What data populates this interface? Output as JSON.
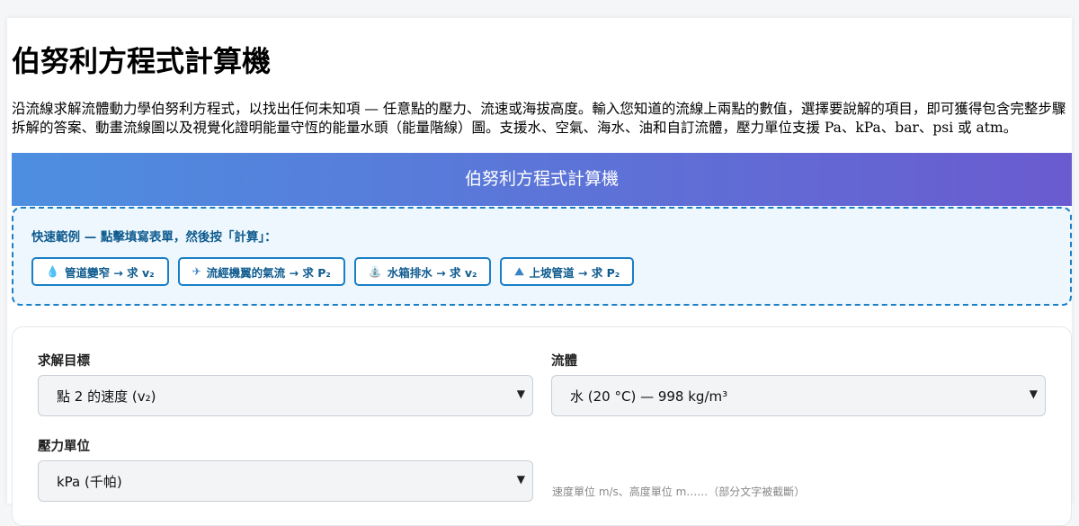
{
  "page": {
    "title": "伯努利方程式計算機",
    "description": "沿流線求解流體動力學伯努利方程式，以找出任何未知項 — 任意點的壓力、流速或海拔高度。輸入您知道的流線上兩點的數值，選擇要說解的項目，即可獲得包含完整步驟拆解的答案、動畫流線圖以及視覺化證明能量守恆的能量水頭（能量階線）圖。支援水、空氣、海水、油和自訂流體，壓力單位支援 Pa、kPa、bar、psi 或 atm。"
  },
  "banner": {
    "title": "伯努利方程式計算機"
  },
  "examples": {
    "label": "快速範例 — 點擊填寫表單，然後按「計算」：",
    "buttons": [
      {
        "icon": "droplet-icon",
        "glyph": "💧",
        "label": "管道變窄 → 求 v₂"
      },
      {
        "icon": "airplane-icon",
        "glyph": "✈",
        "label": "流經機翼的氣流 → 求 P₂"
      },
      {
        "icon": "fountain-icon",
        "glyph": "⛲",
        "label": "水箱排水 → 求 v₂"
      },
      {
        "icon": "mountain-icon",
        "glyph": "⛰",
        "label": "上坡管道 → 求 P₂"
      }
    ]
  },
  "form": {
    "solve_for": {
      "label": "求解目標",
      "value": "點 2 的速度 (v₂)"
    },
    "fluid": {
      "label": "流體",
      "value": "水 (20 °C) — 998 kg/m³"
    },
    "pressure_unit": {
      "label": "壓力單位",
      "value": "kPa (千帕)"
    },
    "hint": "速度單位 m/s、高度單位 m……（部分文字被截斷）"
  }
}
